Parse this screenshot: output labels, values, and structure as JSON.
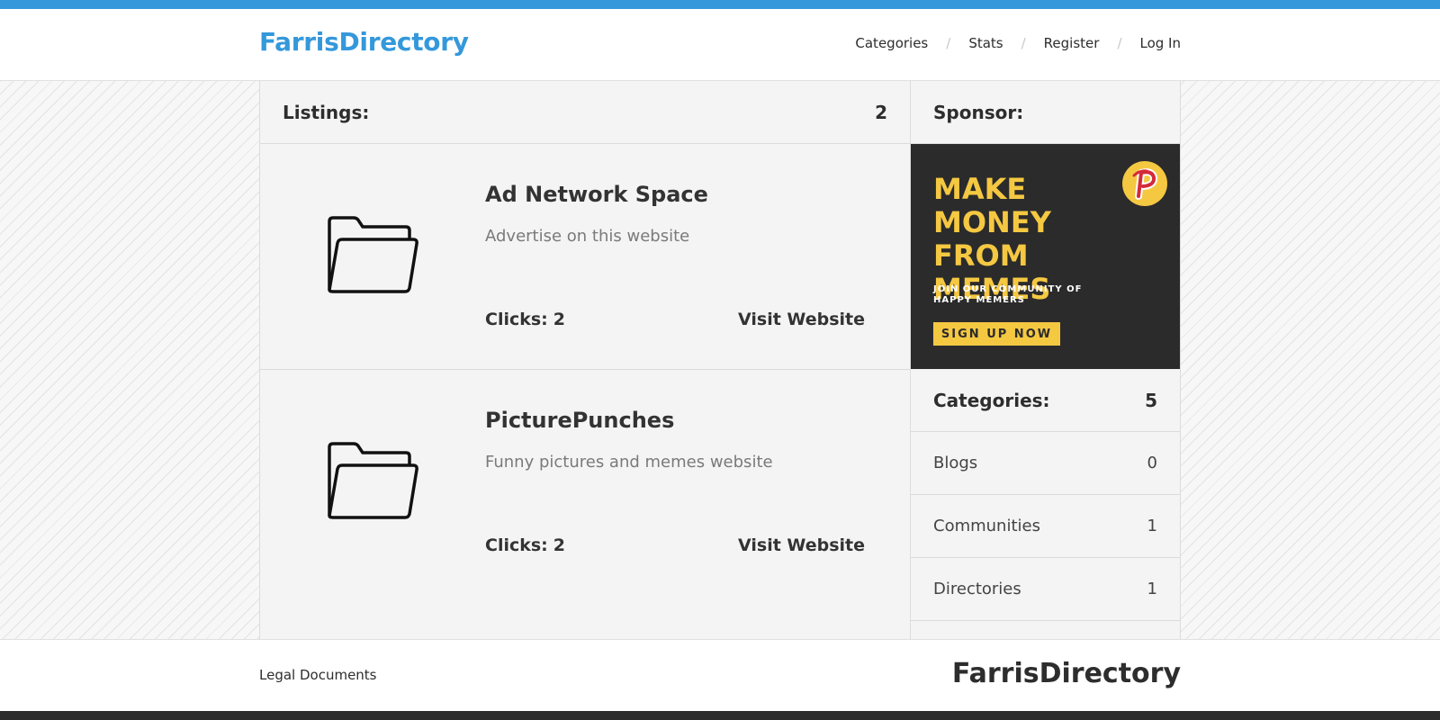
{
  "colors": {
    "accent": "#3498db",
    "dark": "#2d2d2d",
    "ad_yellow": "#f5c842",
    "ad_bg": "#2b2b2b"
  },
  "header": {
    "logo": "FarrisDirectory",
    "nav": [
      {
        "label": "Categories"
      },
      {
        "label": "Stats"
      },
      {
        "label": "Register"
      },
      {
        "label": "Log In"
      }
    ],
    "separator": "/"
  },
  "listings": {
    "label": "Listings:",
    "count": "2",
    "items": [
      {
        "title": "Ad Network Space",
        "description": "Advertise on this website",
        "clicks_label": "Clicks:",
        "clicks": "2",
        "visit_label": "Visit Website",
        "icon": "folder-icon"
      },
      {
        "title": "PicturePunches",
        "description": "Funny pictures and memes website",
        "clicks_label": "Clicks:",
        "clicks": "2",
        "visit_label": "Visit Website",
        "icon": "folder-icon"
      }
    ]
  },
  "sponsor": {
    "label": "Sponsor:",
    "ad": {
      "headline_lines": [
        "MAKE",
        "MONEY",
        "FROM MEMES"
      ],
      "sub_lines": [
        "JOIN OUR COMMUNITY OF",
        "HAPPY MEMERS"
      ],
      "button": "SIGN UP NOW",
      "logo": "p-logo-icon"
    }
  },
  "categories": {
    "label": "Categories:",
    "count": "5",
    "items": [
      {
        "name": "Blogs",
        "count": "0"
      },
      {
        "name": "Communities",
        "count": "1"
      },
      {
        "name": "Directories",
        "count": "1"
      }
    ]
  },
  "footer": {
    "link": "Legal Documents",
    "logo": "FarrisDirectory"
  }
}
